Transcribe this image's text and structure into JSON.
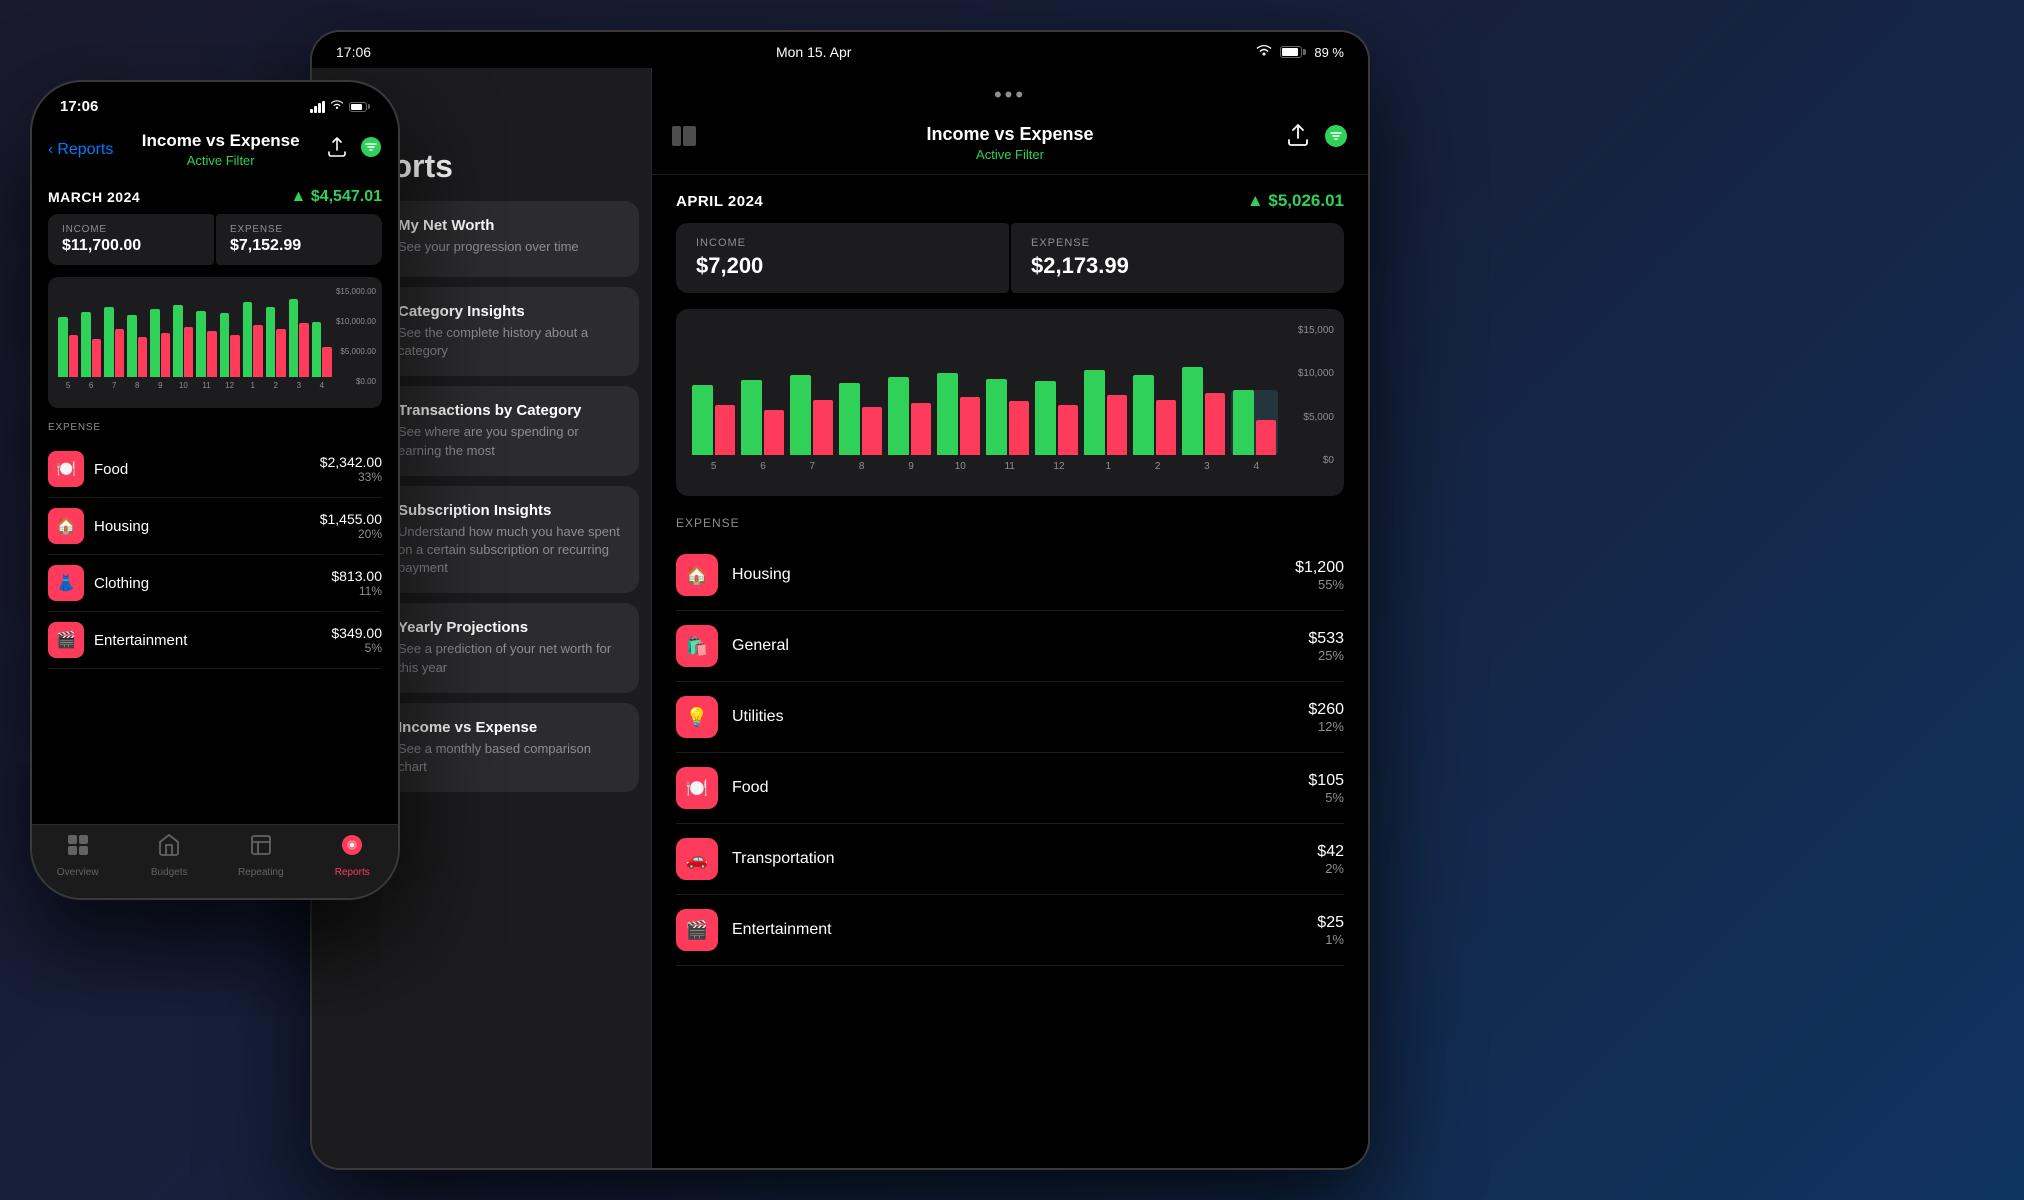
{
  "tablet": {
    "status": {
      "time": "17:06",
      "date": "Mon 15. Apr",
      "wifi": "WiFi",
      "battery": "89 %"
    },
    "left_panel": {
      "reports_title": "Reports",
      "items": [
        {
          "id": "net-worth",
          "title": "My Net Worth",
          "subtitle": "See your progression over time",
          "icon": "📈",
          "color": "#ff3b5c"
        },
        {
          "id": "category-insights",
          "title": "Category Insights",
          "subtitle": "See the complete history about a category",
          "icon": "📉",
          "color": "#30d158"
        },
        {
          "id": "transactions-category",
          "title": "Transactions by Category",
          "subtitle": "See where are you spending or earning the most",
          "icon": "🎯",
          "color": "#636366"
        },
        {
          "id": "subscription-insights",
          "title": "Subscription Insights",
          "subtitle": "Understand how much you have spent on a certain subscription or recurring payment",
          "icon": "ℹ️",
          "color": "#007aff"
        },
        {
          "id": "yearly-projections",
          "title": "Yearly Projections",
          "subtitle": "See a prediction of your net worth for this year",
          "icon": "📊",
          "color": "#30d158"
        },
        {
          "id": "income-vs-expense",
          "title": "Income vs Expense",
          "subtitle": "See a monthly based comparison chart",
          "icon": "📋",
          "color": "#ff9500"
        }
      ]
    },
    "right_panel": {
      "title": "Income vs Expense",
      "subtitle": "Active Filter",
      "period": "APRIL 2024",
      "net_amount": "▲ $5,026.01",
      "income_label": "INCOME",
      "income_value": "$7,200",
      "expense_label": "EXPENSE",
      "expense_value": "$2,173.99",
      "chart": {
        "y_labels": [
          "$15,000",
          "$10,000",
          "$5,000",
          "$0"
        ],
        "x_labels": [
          "5",
          "6",
          "7",
          "8",
          "9",
          "10",
          "11",
          "12",
          "1",
          "2",
          "3",
          "4"
        ],
        "bars": [
          {
            "green": 70,
            "red": 50
          },
          {
            "green": 75,
            "red": 45
          },
          {
            "green": 80,
            "red": 55
          },
          {
            "green": 72,
            "red": 48
          },
          {
            "green": 78,
            "red": 52
          },
          {
            "green": 82,
            "red": 58
          },
          {
            "green": 76,
            "red": 54
          },
          {
            "green": 74,
            "red": 50
          },
          {
            "green": 85,
            "red": 60
          },
          {
            "green": 80,
            "red": 55
          },
          {
            "green": 88,
            "red": 62
          },
          {
            "green": 65,
            "red": 35,
            "highlight": true
          }
        ]
      },
      "expense_section_label": "EXPENSE",
      "expenses": [
        {
          "name": "Housing",
          "icon": "🏠",
          "amount": "$1,200",
          "percent": "55%"
        },
        {
          "name": "General",
          "icon": "🛍️",
          "amount": "$533",
          "percent": "25%"
        },
        {
          "name": "Utilities",
          "icon": "💡",
          "amount": "$260",
          "percent": "12%"
        },
        {
          "name": "Food",
          "icon": "🍽️",
          "amount": "$105",
          "percent": "5%"
        },
        {
          "name": "Transportation",
          "icon": "🚗",
          "amount": "$42",
          "percent": "2%"
        },
        {
          "name": "Entertainment",
          "icon": "🎬",
          "amount": "$25",
          "percent": "1%"
        }
      ]
    }
  },
  "phone": {
    "status": {
      "time": "17:06",
      "signal": "signal",
      "wifi": "wifi",
      "battery": "battery"
    },
    "nav": {
      "back_label": "Reports",
      "title": "Income vs Expense",
      "subtitle": "Active Filter"
    },
    "period": "MARCH 2024",
    "net_amount": "▲ $4,547.01",
    "income_label": "INCOME",
    "income_value": "$11,700.00",
    "expense_label": "EXPENSE",
    "expense_value": "$7,152.99",
    "chart": {
      "y_labels": [
        "$15,000.00",
        "$10,000.00",
        "$5,000.00",
        "$0.00"
      ],
      "x_labels": [
        "5",
        "6",
        "7",
        "8",
        "9",
        "10",
        "11",
        "12",
        "1",
        "2",
        "3",
        "4"
      ],
      "bars": [
        {
          "green": 60,
          "red": 42
        },
        {
          "green": 65,
          "red": 38
        },
        {
          "green": 70,
          "red": 48
        },
        {
          "green": 62,
          "red": 40
        },
        {
          "green": 68,
          "red": 44
        },
        {
          "green": 72,
          "red": 50
        },
        {
          "green": 66,
          "red": 46
        },
        {
          "green": 64,
          "red": 42
        },
        {
          "green": 75,
          "red": 52
        },
        {
          "green": 70,
          "red": 48
        },
        {
          "green": 78,
          "red": 54
        },
        {
          "green": 55,
          "red": 30
        }
      ]
    },
    "expense_section_label": "EXPENSE",
    "expenses": [
      {
        "name": "Food",
        "icon": "🍽️",
        "amount": "$2,342.00",
        "percent": "33%"
      },
      {
        "name": "Housing",
        "icon": "🏠",
        "amount": "$1,455.00",
        "percent": "20%"
      },
      {
        "name": "Clothing",
        "icon": "👗",
        "amount": "$813.00",
        "percent": "11%"
      },
      {
        "name": "Entertainment",
        "icon": "🎬",
        "amount": "$349.00",
        "percent": "5%"
      }
    ],
    "tabbar": {
      "tabs": [
        {
          "label": "Overview",
          "icon": "⊞",
          "active": false
        },
        {
          "label": "Budgets",
          "icon": "◇",
          "active": false
        },
        {
          "label": "Repeating",
          "icon": "⊟",
          "active": false
        },
        {
          "label": "Reports",
          "icon": "◉",
          "active": true
        }
      ]
    }
  }
}
